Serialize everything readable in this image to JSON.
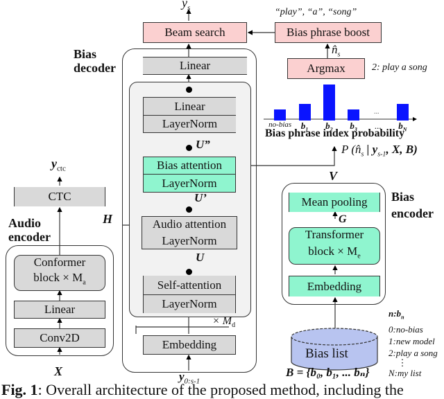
{
  "decoder": {
    "output_label": "y",
    "output_sub": "s",
    "beam_search": "Beam search",
    "linear_top": "Linear",
    "title_line1": "Bias",
    "title_line2": "decoder",
    "ff_linear": "Linear",
    "ff_layernorm": "LayerNorm",
    "u_double_prime": "U”",
    "bias_attention": "Bias attention",
    "bias_layernorm": "LayerNorm",
    "u_prime": "U’",
    "audio_attention": "Audio attention",
    "audio_layernorm": "LayerNorm",
    "u": "U",
    "self_attention": "Self-attention",
    "self_layernorm": "LayerNorm",
    "repeat_label": "× M",
    "repeat_sub": "d",
    "embedding": "Embedding",
    "input_label": "y",
    "input_sub": "0:s-1"
  },
  "audio_encoder": {
    "ctc_output": "y",
    "ctc_output_sub": "ctc",
    "ctc": "CTC",
    "title_line1": "Audio",
    "title_line2": "encoder",
    "h_label": "H",
    "conformer_line1": "Conformer",
    "conformer_line2": "block × M",
    "conformer_sub": "a",
    "linear": "Linear",
    "conv2d": "Conv2D",
    "input_label": "X"
  },
  "bias_boost": {
    "phrase_words": "“play”, “a”, “song”",
    "bias_phrase_boost": "Bias phrase boost",
    "n_hat": "n̂",
    "n_hat_sub": "s",
    "argmax": "Argmax",
    "argmax_result": "2: play a song",
    "chart_title": "Bias phrase index probability",
    "probability_label": "P (n̂",
    "probability_sub": "s",
    "probability_rest": " | y",
    "probability_sub2": "s-1",
    "probability_tail": ", X, B)"
  },
  "bias_encoder": {
    "v_label": "V",
    "title_line1": "Bias",
    "title_line2": "encoder",
    "mean_pooling": "Mean pooling",
    "g_label": "G",
    "transformer_line1": "Transformer",
    "transformer_line2": "block × M",
    "transformer_sub": "e",
    "embedding": "Embedding",
    "bias_list": "Bias list",
    "set_label": "B = {b₀, b₁, ... bₙ}",
    "list_header": "n:b",
    "list_header_sub": "n",
    "list_items": [
      "0:no-bias",
      "1:new model",
      "2:play a song",
      "⋮",
      "N:my list"
    ]
  },
  "chart_data": {
    "type": "bar",
    "title": "Bias phrase index probability",
    "categories": [
      "no-bias",
      "b1",
      "b2",
      "b3",
      "...",
      "bN"
    ],
    "values": [
      0.2,
      0.3,
      0.65,
      0.2,
      null,
      0.3
    ],
    "xlabel": "",
    "ylabel": "",
    "highlight": "b2"
  },
  "caption": {
    "fig": "Fig. 1",
    "text": ": Overall architecture of the proposed method, including the"
  },
  "colors": {
    "pink": "#fbd0d0",
    "gray": "#d9d9d9",
    "green": "#8ff5cf",
    "bar_blue": "#0a14ff",
    "cylinder": "#b8c4f0"
  }
}
